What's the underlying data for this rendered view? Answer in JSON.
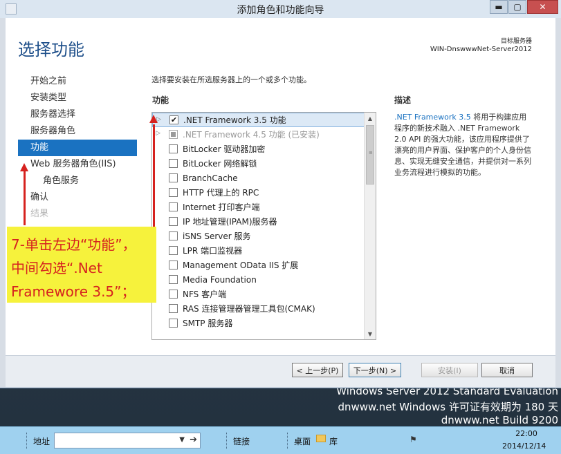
{
  "window": {
    "title": "添加角色和功能向导",
    "minimize": "▬",
    "maximize": "▢",
    "close": "✕"
  },
  "header": {
    "page_title": "选择功能",
    "target_label": "目标服务器",
    "target_server": "WIN-DnswwwNet-Server2012"
  },
  "nav": {
    "items": [
      {
        "label": "开始之前"
      },
      {
        "label": "安装类型"
      },
      {
        "label": "服务器选择"
      },
      {
        "label": "服务器角色"
      },
      {
        "label": "功能"
      },
      {
        "label": "Web 服务器角色(IIS)"
      },
      {
        "label": "角色服务"
      },
      {
        "label": "确认"
      },
      {
        "label": "结果"
      }
    ]
  },
  "main": {
    "instruction": "选择要安装在所选服务器上的一个或多个功能。",
    "features_heading": "功能",
    "description_heading": "描述",
    "features": [
      {
        "label": ".NET Framework 3.5 功能",
        "check": "✔"
      },
      {
        "label": ".NET Framework 4.5 功能 (已安装)",
        "check": ""
      },
      {
        "label": "BitLocker 驱动器加密",
        "check": ""
      },
      {
        "label": "BitLocker 网络解锁",
        "check": ""
      },
      {
        "label": "BranchCache",
        "check": ""
      },
      {
        "label": "HTTP 代理上的 RPC",
        "check": ""
      },
      {
        "label": "Internet 打印客户端",
        "check": ""
      },
      {
        "label": "IP 地址管理(IPAM)服务器",
        "check": ""
      },
      {
        "label": "iSNS Server 服务",
        "check": ""
      },
      {
        "label": "LPR 端口监视器",
        "check": ""
      },
      {
        "label": "Management OData IIS 扩展",
        "check": ""
      },
      {
        "label": "Media Foundation",
        "check": ""
      },
      {
        "label": "NFS 客户端",
        "check": ""
      },
      {
        "label": "RAS 连接管理器管理工具包(CMAK)",
        "check": ""
      },
      {
        "label": "SMTP 服务器",
        "check": ""
      }
    ],
    "description_link": ".NET Framework 3.5",
    "description_body": " 将用于构建应用程序的新技术融入 .NET Framework 2.0 API 的强大功能，该应用程序提供了漂亮的用户界面、保护客户的个人身份信息、实现无缝安全通信，并提供对一系列业务流程进行模拟的功能。"
  },
  "footer": {
    "prev": "< 上一步(P)",
    "next": "下一步(N) >",
    "install": "安装(I)",
    "cancel": "取消"
  },
  "annotation": {
    "line1": "7-单击左边“功能”，",
    "line2": "中间勾选“.Net",
    "line3": "Framewore 3.5”；"
  },
  "watermark": {
    "line1": "Windows Server 2012 Standard Evaluation",
    "line2": "dnwww.net Windows 许可证有效期为 180 天",
    "line3": "dnwww.net Build 9200"
  },
  "taskbar": {
    "address_label": "地址",
    "links_label": "链接",
    "desktop_label": "桌面",
    "library_label": "库",
    "time": "22:00",
    "date": "2014/12/14"
  }
}
